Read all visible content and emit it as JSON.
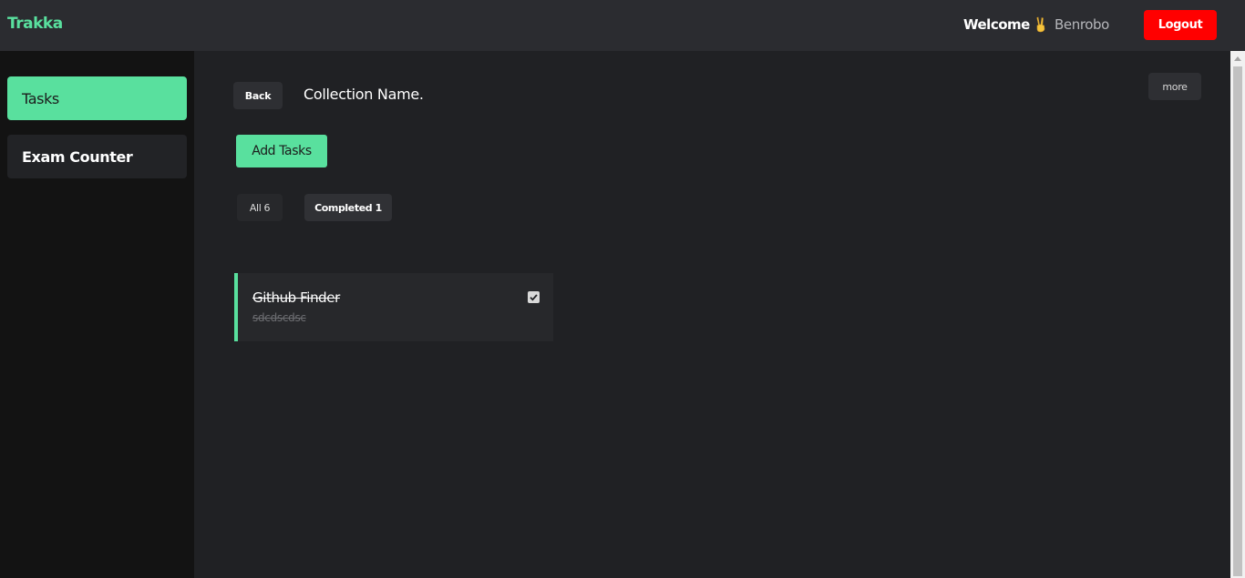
{
  "header": {
    "brand": "Trakka",
    "welcome": "Welcome",
    "username": "Benrobo",
    "logout_label": "Logout"
  },
  "sidebar": {
    "items": [
      {
        "label": "Tasks",
        "active": true
      },
      {
        "label": "Exam Counter",
        "active": false
      }
    ]
  },
  "main": {
    "back_label": "Back",
    "collection_name": "Collection Name.",
    "more_label": "more",
    "add_label": "Add Tasks",
    "filters": [
      {
        "label": "All 6"
      },
      {
        "label": "Completed 1"
      }
    ],
    "tasks": [
      {
        "title": "Github Finder",
        "description": "sdcdscdsc",
        "completed": true
      }
    ]
  },
  "colors": {
    "accent": "#59e09e",
    "danger": "#ff0000",
    "background": "#202124",
    "topbar": "#2b2c30",
    "sidebar": "#131313"
  },
  "icons": {
    "welcome_icon": "victory-hand-icon",
    "task_checkbox": "checkmark-icon",
    "scroll_up": "arrow-up-icon"
  }
}
